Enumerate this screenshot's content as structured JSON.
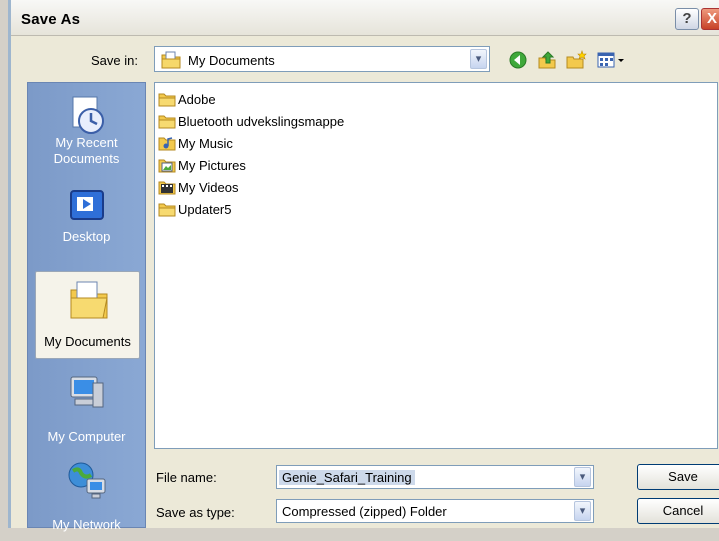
{
  "window": {
    "title": "Save As"
  },
  "titlebar": {
    "help_label": "?",
    "close_label": "X"
  },
  "save_in": {
    "label": "Save in:",
    "value": "My Documents",
    "drop": "▾"
  },
  "places": [
    {
      "label": "My Recent Documents",
      "icon": "recent-documents-icon"
    },
    {
      "label": "Desktop",
      "icon": "desktop-icon"
    },
    {
      "label": "My Documents",
      "icon": "my-documents-icon",
      "selected": true
    },
    {
      "label": "My Computer",
      "icon": "my-computer-icon"
    },
    {
      "label": "My Network",
      "icon": "my-network-icon"
    }
  ],
  "files": [
    "Adobe",
    "Bluetooth udvekslingsmappe",
    "My Music",
    "My Pictures",
    "My Videos",
    "Updater5"
  ],
  "file_name": {
    "label": "File name:",
    "value": "Genie_Safari_Training"
  },
  "save_as_type": {
    "label": "Save as type:",
    "value": "Compressed (zipped) Folder"
  },
  "buttons": {
    "save": "Save",
    "cancel": "Cancel"
  },
  "colors": {
    "places_bar": "#7c9ac8",
    "dialog_bg": "#ece9d8",
    "folder": "#f3c94c"
  }
}
